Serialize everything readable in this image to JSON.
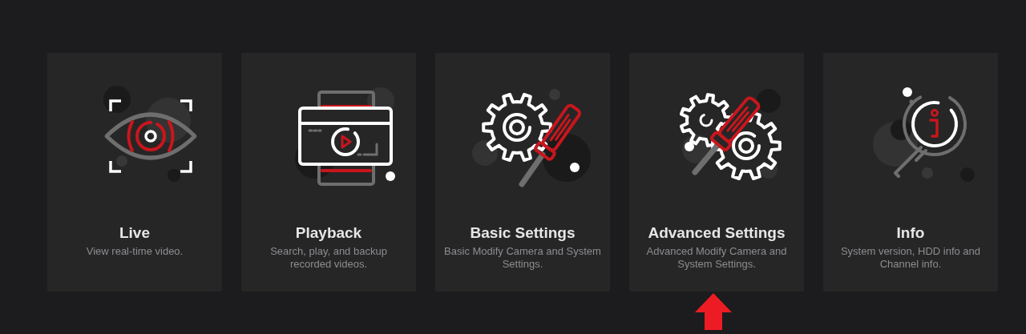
{
  "cards": [
    {
      "title": "Live",
      "description": "View real-time video.",
      "marked": false
    },
    {
      "title": "Playback",
      "description": "Search, play, and backup recorded videos.",
      "marked": false
    },
    {
      "title": "Basic Settings",
      "description": "Basic Modify Camera and System Settings.",
      "marked": false
    },
    {
      "title": "Advanced Settings",
      "description": "Advanced Modify Camera and System Settings.",
      "marked": true
    },
    {
      "title": "Info",
      "description": "System version, HDD info and Channel info.",
      "marked": false
    }
  ]
}
